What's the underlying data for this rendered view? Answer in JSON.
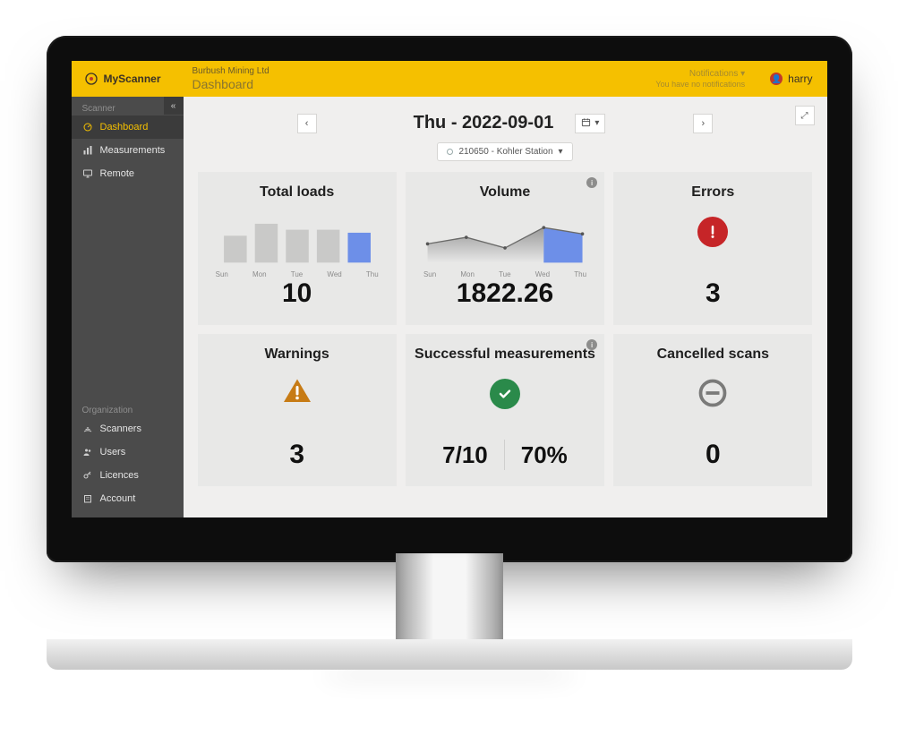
{
  "brand": "MyScanner",
  "breadcrumb": {
    "org": "Burbush Mining Ltd",
    "page": "Dashboard"
  },
  "notifications": {
    "title": "Notifications",
    "msg": "You have no notifications"
  },
  "user": {
    "name": "harry"
  },
  "sidebar": {
    "section1": "Scanner",
    "items1": [
      {
        "label": "Dashboard"
      },
      {
        "label": "Measurements"
      },
      {
        "label": "Remote"
      }
    ],
    "section2": "Organization",
    "items2": [
      {
        "label": "Scanners"
      },
      {
        "label": "Users"
      },
      {
        "label": "Licences"
      },
      {
        "label": "Account"
      }
    ]
  },
  "date_title": "Thu - 2022-09-01",
  "station": "210650 - Kohler Station",
  "days": [
    "Sun",
    "Mon",
    "Tue",
    "Wed",
    "Thu"
  ],
  "cards": {
    "total_loads": {
      "title": "Total loads",
      "value": "10"
    },
    "volume": {
      "title": "Volume",
      "value": "1822.26"
    },
    "errors": {
      "title": "Errors",
      "value": "3"
    },
    "warnings": {
      "title": "Warnings",
      "value": "3"
    },
    "success": {
      "title": "Successful measurements",
      "ratio": "7/10",
      "pct": "70%"
    },
    "cancelled": {
      "title": "Cancelled scans",
      "value": "0"
    }
  },
  "chart_data": [
    {
      "type": "bar",
      "title": "Total loads",
      "categories": [
        "Sun",
        "Mon",
        "Tue",
        "Wed",
        "Thu"
      ],
      "values": [
        9,
        13,
        11,
        11,
        10
      ],
      "ylim": [
        0,
        15
      ]
    },
    {
      "type": "area",
      "title": "Volume",
      "categories": [
        "Sun",
        "Mon",
        "Tue",
        "Wed",
        "Thu"
      ],
      "values": [
        1700,
        1780,
        1650,
        1900,
        1822.26
      ],
      "ylim": [
        1500,
        2000
      ]
    }
  ]
}
